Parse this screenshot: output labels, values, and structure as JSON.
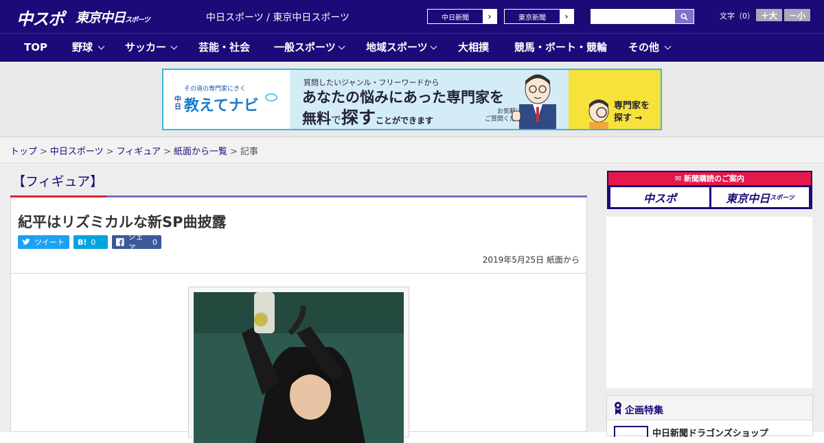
{
  "header": {
    "logo_chuspo": "中スポ",
    "logo_tokyo": "東京中日",
    "logo_tokyo_small": "スポーツ",
    "site_name": "中日スポーツ / 東京中日スポーツ",
    "paper_buttons": [
      {
        "label": "中日新聞"
      },
      {
        "label": "東京新聞"
      }
    ],
    "search": {
      "placeholder": "",
      "value": ""
    },
    "font_size_label": "文字（0）",
    "font_larger": "＋大",
    "font_smaller": "－小"
  },
  "nav": {
    "items": [
      {
        "label": "TOP",
        "dropdown": false
      },
      {
        "label": "野球",
        "dropdown": true
      },
      {
        "label": "サッカー",
        "dropdown": true
      },
      {
        "label": "芸能・社会",
        "dropdown": false
      },
      {
        "label": "一般スポーツ",
        "dropdown": true
      },
      {
        "label": "地域スポーツ",
        "dropdown": true
      },
      {
        "label": "大相撲",
        "dropdown": false
      },
      {
        "label": "競馬・ボート・競輪",
        "dropdown": false
      },
      {
        "label": "その他",
        "dropdown": true
      }
    ]
  },
  "banner": {
    "tagline": "その道の専門家にきく",
    "chunichi": "中日",
    "brand": "教えてナビ",
    "question": "質問したいジャンル・フリーワードから",
    "headline1": "あなたの悩みにあった専門家を",
    "headline2a": "無料",
    "headline2b": "で",
    "headline2c": "探す",
    "headline2d": "ことができます",
    "note1": "お気軽に",
    "note2": "ご質問ください！",
    "cta1": "専門家を",
    "cta2": "探す →"
  },
  "breadcrumb": {
    "items": [
      "トップ",
      "中日スポーツ",
      "フィギュア",
      "紙面から一覧"
    ],
    "current": "記事"
  },
  "article": {
    "category": "【フィギュア】",
    "title": "紀平はリズミカルな新SP曲披露",
    "share": {
      "tweet": "ツイート",
      "hatena": "B!",
      "hatena_count": "0",
      "facebook": "シェア",
      "facebook_count": "0"
    },
    "date": "2019年5月25日 紙面から"
  },
  "sidebar": {
    "subscribe_head": "新聞購読のご案内",
    "subscribe_chuspo": "中スポ",
    "subscribe_tokyo": "東京中日",
    "subscribe_tokyo_small": "スポーツ",
    "feature_title": "企画特集",
    "feature_item": "中日新聞ドラゴンズショップ"
  },
  "colors": {
    "brand_navy": "#1b0a78",
    "accent_red": "#d8252e",
    "banner_border": "#39b6e3",
    "twitter": "#1da1f2",
    "hatena": "#00a4de",
    "facebook": "#3b5998"
  }
}
